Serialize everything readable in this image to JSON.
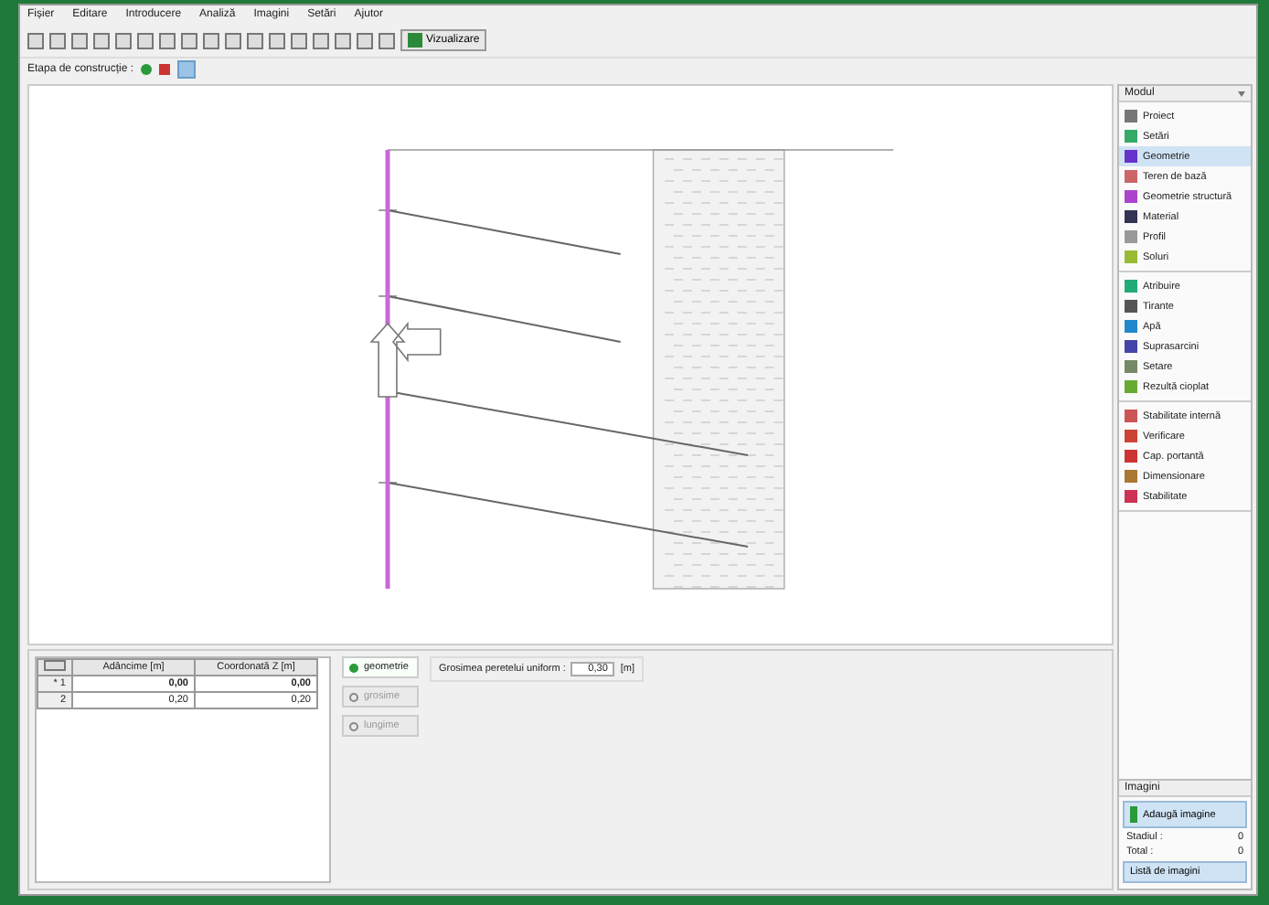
{
  "menu": [
    "Fișier",
    "Editare",
    "Introducere",
    "Analiză",
    "Imagini",
    "Setări",
    "Ajutor"
  ],
  "toolbar": {
    "view_button": "Vizualizare"
  },
  "stage_bar": {
    "label": "Etapa de construcție :"
  },
  "sidebar": {
    "title": "Modul",
    "groups": [
      [
        {
          "label": "Proiect",
          "selected": false
        },
        {
          "label": "Setări",
          "selected": false
        },
        {
          "label": "Geometrie",
          "selected": true
        },
        {
          "label": "Teren de bază",
          "selected": false
        },
        {
          "label": "Geometrie structură",
          "selected": false
        },
        {
          "label": "Material",
          "selected": false
        },
        {
          "label": "Profil",
          "selected": false
        },
        {
          "label": "Soluri",
          "selected": false
        }
      ],
      [
        {
          "label": "Atribuire",
          "selected": false
        },
        {
          "label": "Tirante",
          "selected": false
        },
        {
          "label": "Apă",
          "selected": false
        },
        {
          "label": "Suprasarcini",
          "selected": false
        },
        {
          "label": "Setare",
          "selected": false
        },
        {
          "label": "Rezultă cioplat",
          "selected": false
        }
      ],
      [
        {
          "label": "Stabilitate internă",
          "selected": false
        },
        {
          "label": "Verificare",
          "selected": false
        },
        {
          "label": "Cap. portantă",
          "selected": false
        },
        {
          "label": "Dimensionare",
          "selected": false
        },
        {
          "label": "Stabilitate",
          "selected": false
        }
      ]
    ]
  },
  "table": {
    "columns": [
      "Adâncime [m]",
      "Coordonată Z [m]"
    ],
    "rows": [
      {
        "marker": "*",
        "number": "1",
        "cells": [
          "0,00",
          "0,00"
        ],
        "bold": true
      },
      {
        "marker": "",
        "number": "2",
        "cells": [
          "0,20",
          "0,20"
        ],
        "bold": false
      }
    ]
  },
  "options": [
    {
      "label": "geometrie",
      "selected": true
    },
    {
      "label": "grosime",
      "selected": false
    },
    {
      "label": "lungime",
      "selected": false
    }
  ],
  "thickness_field": {
    "label": "Grosimea peretelui uniform :",
    "value": "0,30",
    "unit": "[m]"
  },
  "images": {
    "title": "Imagini",
    "add_button": "Adaugă imagine",
    "counts": [
      {
        "label": "Stadiul :",
        "value": "0"
      },
      {
        "label": "Total :",
        "value": "0"
      }
    ],
    "list_button": "Listă de imagini"
  }
}
